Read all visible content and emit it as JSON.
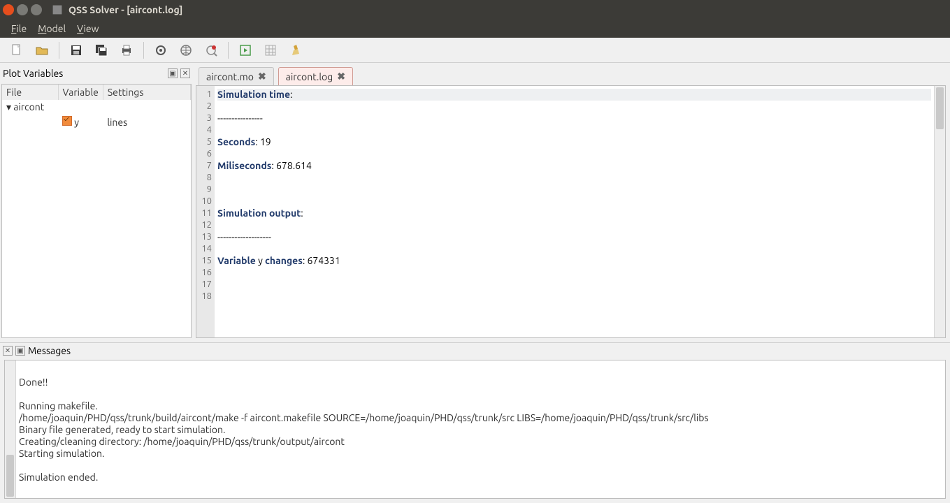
{
  "window": {
    "title": "QSS Solver - [aircont.log]"
  },
  "menu": {
    "file": "File",
    "model": "Model",
    "view": "View"
  },
  "toolbar_icons": [
    "new",
    "open",
    "save",
    "saveall",
    "print",
    "gear",
    "globe",
    "debug",
    "run",
    "grid",
    "broom"
  ],
  "plotvars": {
    "title": "Plot Variables",
    "headers": {
      "file": "File",
      "variable": "Variable",
      "settings": "Settings"
    },
    "root": "aircont",
    "rows": [
      {
        "var": "y",
        "settings": "lines"
      }
    ]
  },
  "tabs": [
    {
      "label": "aircont.mo",
      "active": false
    },
    {
      "label": "aircont.log",
      "active": true
    }
  ],
  "log": {
    "lines": [
      {
        "n": 1,
        "segs": [
          [
            "kw",
            "Simulation time"
          ],
          [
            "",
            ":"
          ]
        ]
      },
      {
        "n": 2,
        "segs": []
      },
      {
        "n": 3,
        "segs": [
          [
            "",
            "----------------"
          ]
        ]
      },
      {
        "n": 4,
        "segs": []
      },
      {
        "n": 5,
        "segs": [
          [
            "kw",
            "Seconds"
          ],
          [
            "",
            ": 19"
          ]
        ]
      },
      {
        "n": 6,
        "segs": []
      },
      {
        "n": 7,
        "segs": [
          [
            "kw",
            "Miliseconds"
          ],
          [
            "",
            ": 678.614"
          ]
        ]
      },
      {
        "n": 8,
        "segs": []
      },
      {
        "n": 9,
        "segs": []
      },
      {
        "n": 10,
        "segs": []
      },
      {
        "n": 11,
        "segs": [
          [
            "kw",
            "Simulation output"
          ],
          [
            "",
            ":"
          ]
        ]
      },
      {
        "n": 12,
        "segs": []
      },
      {
        "n": 13,
        "segs": [
          [
            "",
            "-------------------"
          ]
        ]
      },
      {
        "n": 14,
        "segs": []
      },
      {
        "n": 15,
        "segs": [
          [
            "kw",
            "Variable"
          ],
          [
            "",
            " y "
          ],
          [
            "kw",
            "changes"
          ],
          [
            "",
            ": 674331"
          ]
        ]
      },
      {
        "n": 16,
        "segs": []
      },
      {
        "n": 17,
        "segs": []
      },
      {
        "n": 18,
        "segs": []
      }
    ]
  },
  "messages": {
    "title": "Messages",
    "lines": [
      "",
      "Done!!",
      "",
      "Running makefile.",
      "/home/joaquin/PHD/qss/trunk/build/aircont/make -f aircont.makefile SOURCE=/home/joaquin/PHD/qss/trunk/src LIBS=/home/joaquin/PHD/qss/trunk/src/libs",
      "Binary file generated, ready to start simulation.",
      "Creating/cleaning directory: /home/joaquin/PHD/qss/trunk/output/aircont",
      "Starting simulation.",
      "",
      "Simulation ended."
    ]
  }
}
